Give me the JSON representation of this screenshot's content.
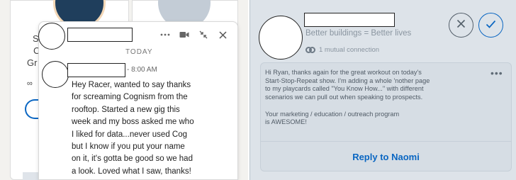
{
  "background_page": {
    "fragments": [
      "S",
      "C",
      "Gr",
      "∞"
    ]
  },
  "chat": {
    "day_label": "TODAY",
    "time": "- 8:00 AM",
    "message_lines": [
      "Hey Racer, wanted to say thanks",
      "for screaming Cognism from the",
      "rooftop. Started a new gig this",
      "week and my boss asked me who",
      "I liked for data...never used Cog",
      "but I know if you put your name",
      "on it, it's gotta be good so we had",
      "a look. Loved what I saw, thanks!"
    ],
    "header_icons": [
      "more-icon",
      "video-icon",
      "collapse-icon",
      "close-icon"
    ]
  },
  "request": {
    "tagline": "Better buildings = Better lives",
    "mutual": "1 mutual connection",
    "note_lines": [
      "Hi Ryan, thanks again for the great workout on today's",
      "Start-Stop-Repeat show. I'm adding a whole 'nother page",
      "to my playcards called \"You Know How...\" with different",
      "scenarios we can pull out when speaking to prospects."
    ],
    "note_lines_2": [
      "Your marketing / education / outreach program",
      "is AWESOME!"
    ],
    "more": "•••",
    "reply_label": "Reply to Naomi"
  },
  "colors": {
    "accent": "#0a66c2",
    "muted_text": "#8a95a0",
    "panel_bg": "#dde3e9"
  }
}
